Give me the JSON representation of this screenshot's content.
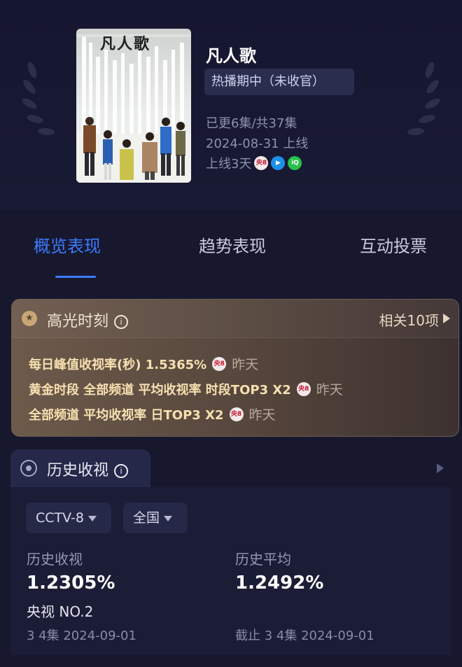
{
  "show": {
    "poster_title": "凡人歌",
    "title": "凡人歌",
    "status": "热播期中（未收官）",
    "episodes": "已更6集/共37集",
    "premiere": "2024-08-31 上线",
    "online_days": "上线3天",
    "channels": [
      "央8",
      "腾讯视频",
      "爱奇艺"
    ]
  },
  "tabs": [
    "概览表现",
    "趋势表现",
    "互动投票"
  ],
  "active_tab": 0,
  "highlight": {
    "title": "高光时刻",
    "related": "相关10项",
    "items": [
      {
        "text": "每日峰值收视率(秒)  1.5365%",
        "channel": "央8",
        "when": "昨天"
      },
      {
        "text": "黄金时段 全部频道 平均收视率  时段TOP3 X2",
        "channel": "央8",
        "when": "昨天"
      },
      {
        "text": "全部频道 平均收视率  日TOP3 X2",
        "channel": "央8",
        "when": "昨天"
      }
    ]
  },
  "history": {
    "title": "历史收视",
    "channel_select": "CCTV-8",
    "region_select": "全国",
    "left": {
      "label": "历史收视",
      "value": "1.2305%",
      "rank": "央视 NO.2",
      "footnote": "3 4集 2024-09-01"
    },
    "right": {
      "label": "历史平均",
      "value": "1.2492%",
      "footnote": "截止 3 4集 2024-09-01"
    }
  },
  "colors": {
    "background": "#17182e",
    "accent": "#3d7bff",
    "highlight_gold": "#f6e0b0"
  }
}
